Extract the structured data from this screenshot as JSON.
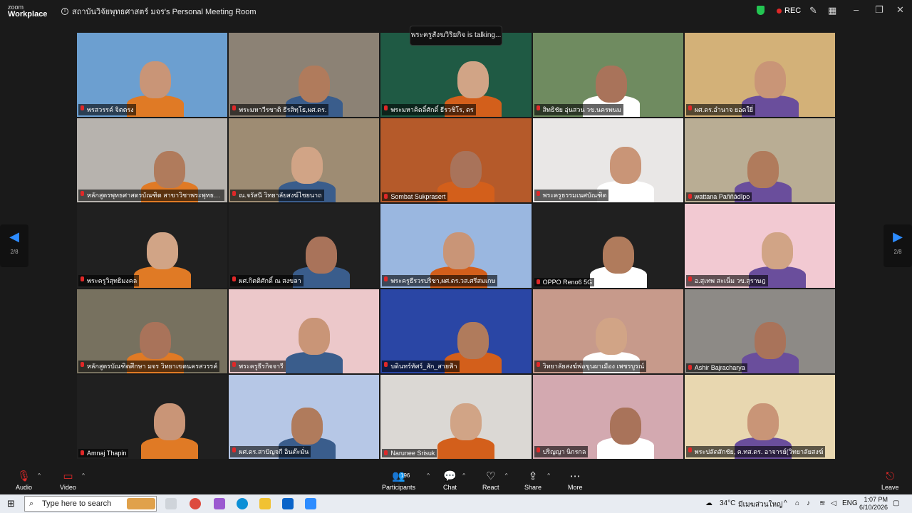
{
  "app": {
    "brand_line1": "zoom",
    "brand_line2": "Workplace",
    "title": "สถาบันวิจัยพุทธศาสตร์ มจร's Personal Meeting Room",
    "rec_label": "REC"
  },
  "talking": "พระครูสังฆวิริยกิจ is talking...",
  "nav": {
    "left_page": "2/8",
    "right_page": "2/8"
  },
  "tiles": [
    {
      "name": "พรสวรรค์ จิตตรง",
      "bg": "#6c9fd0"
    },
    {
      "name": "พระมหาวีรชาติ ธีรสิทฺโธ,ผศ.ดร.",
      "bg": "#8c8275"
    },
    {
      "name": "พระมหาคิดลิ์ศักดิ์ ธีรวชิโร, ดร",
      "bg": "#1f5a44"
    },
    {
      "name": "สิทธิชัย อุ่นสวน วข.นครพนม",
      "bg": "#6f8b60"
    },
    {
      "name": "ผศ.ดร.อำนาจ ยอดใยี่",
      "bg": "#d3b178"
    },
    {
      "name": "หลักสูตรพุทธศาสตรบัณฑิต สาขาวิชาพระพุทธศาสนา วิท...",
      "bg": "#b7b3ae"
    },
    {
      "name": "ณ.จรัสนี วิทยาลัยสงฆ์ไชยนาถ",
      "bg": "#9e8c73"
    },
    {
      "name": "Sombat Sukprasert",
      "bg": "#b55a2a"
    },
    {
      "name": "พระครูธรรมเนศบัณฑิต",
      "bg": "#e9e7e6"
    },
    {
      "name": "wattana Paññādīpo",
      "bg": "#b9ad94"
    },
    {
      "name": "พระครูวิสุทธิมงคล",
      "bg": "#202020"
    },
    {
      "name": "ผศ.กิตติศักดิ์ ณ สงขลา",
      "bg": "#202020"
    },
    {
      "name": "พระครูธีรวรปริชา,ผศ.ดร.วส.ศรีสมเกษ",
      "bg": "#9ab7e0"
    },
    {
      "name": "OPPO Reno6 5G",
      "bg": "#202020"
    },
    {
      "name": "อ.สุเทพ สะเน็ม วข.สุราษฎ",
      "bg": "#f2c9d2"
    },
    {
      "name": "หลักสูตรบัณฑิตศึกษา มจร วิทยาเขตนครสวรรค์",
      "bg": "#77715f"
    },
    {
      "name": "พระครูธีรกิจจารี",
      "bg": "#ecc8ca"
    },
    {
      "name": "บดินทร์ทัศร์_สัก_สายฟ้า",
      "bg": "#2a46a5"
    },
    {
      "name": "วิทยาลัยสงฆ์พ่อขุนผาเมือง เพชรบูรณ์",
      "bg": "#c79a8b"
    },
    {
      "name": "Ashir Bajracharya",
      "bg": "#8d8a86"
    },
    {
      "name": "Amnaj Thapin",
      "bg": "#202020"
    },
    {
      "name": "ผศ.ดร.สาปัญจกี อินต๊ะมั่น",
      "bg": "#b6c7e6"
    },
    {
      "name": "Narunee Srisuk",
      "bg": "#dbd8d4"
    },
    {
      "name": "ปริญญา นิกรกล",
      "bg": "#d3a9b0"
    },
    {
      "name": "พระปลัดสักชัย, ค.ทส.ดร. อาจารย์(วิทยาลัยสงฆ์",
      "bg": "#e8d7b0"
    }
  ],
  "toolbar": {
    "audio": "Audio",
    "video": "Video",
    "participants": "Participants",
    "participants_count": "196",
    "chat": "Chat",
    "react": "React",
    "share": "Share",
    "more": "More",
    "leave": "Leave"
  },
  "taskbar": {
    "search_placeholder": "Type here to search",
    "temp": "34°C",
    "weather": "มีเมฆส่วนใหญ่",
    "lang": "ENG",
    "time": "1:07 PM",
    "date": "6/10/2026"
  }
}
